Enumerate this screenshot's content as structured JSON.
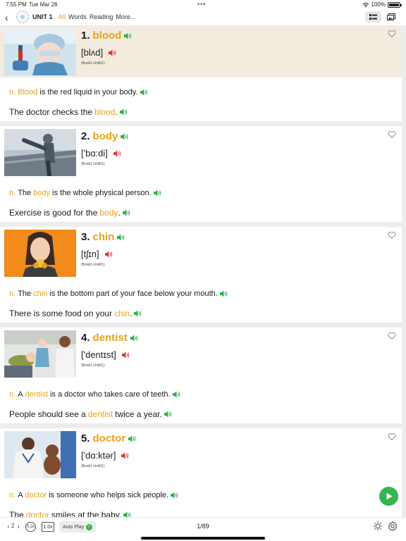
{
  "status_bar": {
    "time": "7:55 PM",
    "date": "Tue Mar 26",
    "battery": "100%",
    "battery_level": 1.0
  },
  "header": {
    "unit_title": "UNIT 1",
    "tabs": [
      {
        "label": "All",
        "active": true
      },
      {
        "label": "Words",
        "active": false
      },
      {
        "label": "Reading",
        "active": false
      },
      {
        "label": "More...",
        "active": false
      }
    ]
  },
  "colors": {
    "accent": "#e8a31a",
    "speaker_green": "#2eb24a",
    "speaker_red": "#e0393b",
    "highlight_bg": "#f3ecde",
    "play_green": "#34b64e"
  },
  "cards": [
    {
      "num": "1.",
      "word": "blood",
      "phonetic": "[blʌd]",
      "source": "(Book1-Unit01)",
      "pos": "n.",
      "def_before": "",
      "def_word": "Blood",
      "def_after": "is the red liquid in your body.",
      "ex_before": "The doctor checks the",
      "ex_word": "blood",
      "ex_after": ".",
      "image": "blood-test-photo"
    },
    {
      "num": "2.",
      "word": "body",
      "phonetic": "['bɑ:di]",
      "source": "(Book1-Unit01)",
      "pos": "n.",
      "def_before": "The",
      "def_word": "body",
      "def_after": "is the whole physical person.",
      "ex_before": "Exercise is good for the",
      "ex_word": "body",
      "ex_after": ".",
      "image": "stretching-man-photo"
    },
    {
      "num": "3.",
      "word": "chin",
      "phonetic": "[tʃɪn]",
      "source": "(Book1-Unit01)",
      "pos": "n.",
      "def_before": "The",
      "def_word": "chin",
      "def_after": "is the bottom part of your face below your mouth.",
      "ex_before": "There is some food on your",
      "ex_word": "chin",
      "ex_after": ".",
      "image": "girl-eating-photo"
    },
    {
      "num": "4.",
      "word": "dentist",
      "phonetic": "['dentɪst]",
      "source": "(Book1-Unit01)",
      "pos": "n.",
      "def_before": "A",
      "def_word": "dentist",
      "def_after": "is a doctor who takes care of teeth.",
      "ex_before": "People should see a",
      "ex_word": "dentist",
      "ex_after": "twice a year.",
      "image": "dentist-photo"
    },
    {
      "num": "5.",
      "word": "doctor",
      "phonetic": "['dɑ:ktər]",
      "source": "(Book1-Unit01)",
      "pos": "n.",
      "def_before": "A",
      "def_word": "doctor",
      "def_after": "is someone who helps sick people.",
      "ex_before": "The",
      "ex_word": "doctor",
      "ex_after": "smiles at the baby.",
      "image": "doctor-baby-photo"
    }
  ],
  "bottom_bar": {
    "repeat": "2",
    "delay": "0.2s",
    "speed": "1.0x",
    "autoplay": "Auto Play",
    "autoplay_on": true,
    "page": "1/89"
  }
}
